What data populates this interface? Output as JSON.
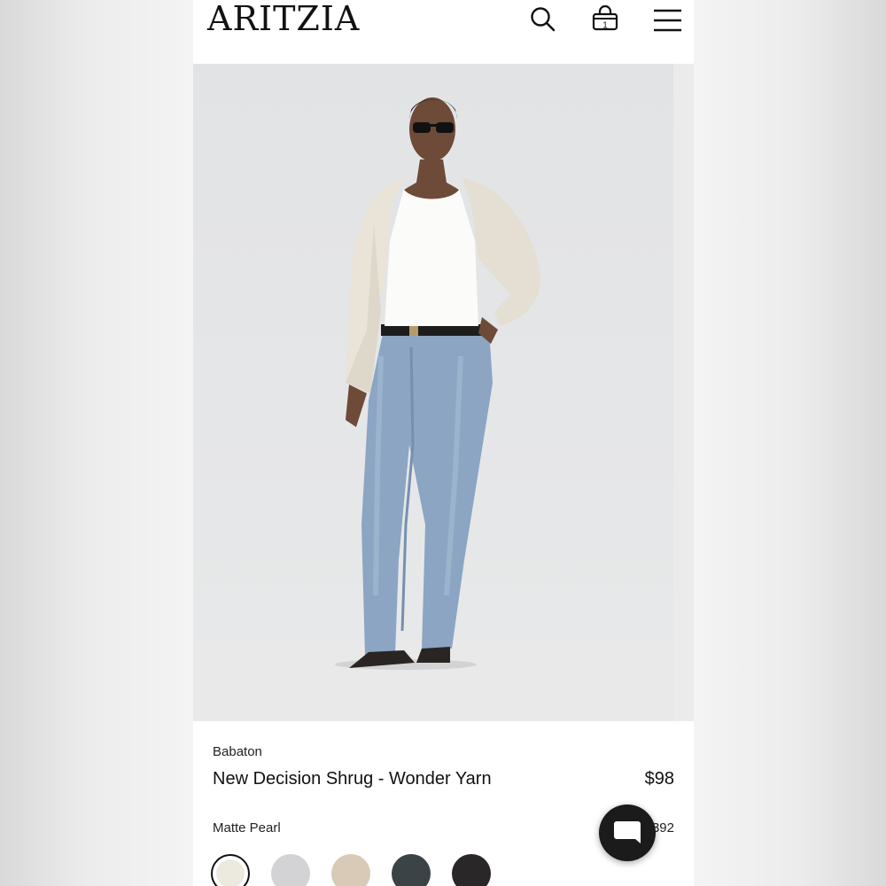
{
  "header": {
    "logo_text": "ARITZIA",
    "icons": [
      "search-icon",
      "shopping-bag-icon",
      "menu-icon"
    ],
    "cart_count": "1"
  },
  "product": {
    "brand": "Babaton",
    "name": "New Decision Shrug - Wonder Yarn",
    "price": "$98",
    "color_label": "Matte Pearl",
    "alt_price_partial": "392"
  },
  "swatches": [
    {
      "color": "#ece9df",
      "selected": true
    },
    {
      "color": "#d3d3d5",
      "selected": false
    },
    {
      "color": "#d8cab6",
      "selected": false
    },
    {
      "color": "#3c4346",
      "selected": false
    },
    {
      "color": "#2a2729",
      "selected": false
    }
  ],
  "chat": {
    "icon": "chat-icon"
  }
}
